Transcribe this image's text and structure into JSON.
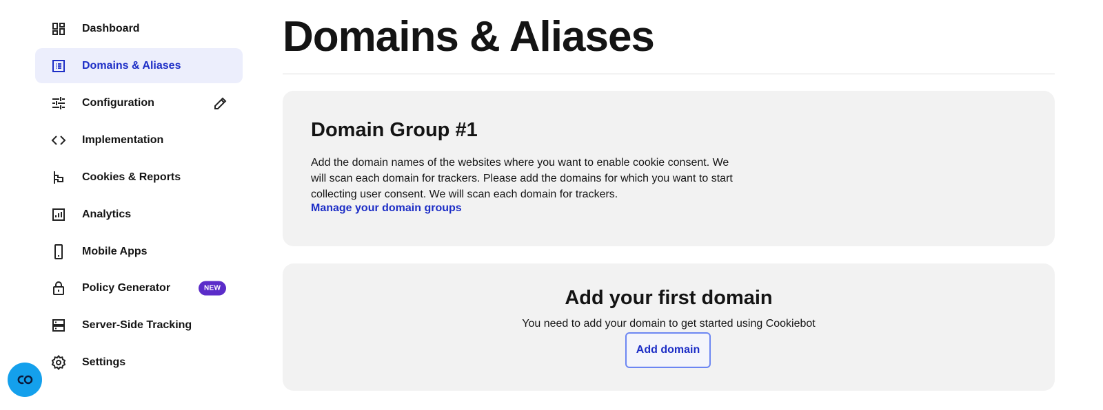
{
  "sidebar": {
    "items": [
      {
        "label": "Dashboard",
        "icon": "dashboard-icon"
      },
      {
        "label": "Domains & Aliases",
        "icon": "list-icon",
        "active": true
      },
      {
        "label": "Configuration",
        "icon": "sliders-icon",
        "action_icon": "pencil-icon"
      },
      {
        "label": "Implementation",
        "icon": "code-icon"
      },
      {
        "label": "Cookies & Reports",
        "icon": "flag-icon"
      },
      {
        "label": "Analytics",
        "icon": "bar-chart-icon"
      },
      {
        "label": "Mobile Apps",
        "icon": "phone-icon"
      },
      {
        "label": "Policy Generator",
        "icon": "lock-icon",
        "badge": "NEW"
      },
      {
        "label": "Server-Side Tracking",
        "icon": "server-icon"
      },
      {
        "label": "Settings",
        "icon": "gear-icon"
      }
    ],
    "fab_icon": "cookiebot-logo-icon"
  },
  "main": {
    "title": "Domains & Aliases",
    "group_card": {
      "title": "Domain Group #1",
      "description": "Add the domain names of the websites where you want to enable cookie consent. We will scan each domain for trackers. Please add the domains for which you want to start collecting user consent. We will scan each domain for trackers.",
      "link": "Manage your domain groups"
    },
    "first_domain_card": {
      "title": "Add your first domain",
      "subtitle": "You need to add your domain to get started using Cookiebot",
      "button": "Add domain"
    }
  },
  "colors": {
    "accent": "#1d2ec6",
    "active_bg": "#eceefc",
    "badge": "#5b2cc9",
    "card_bg": "#f2f2f2",
    "fab": "#14a0ec"
  }
}
